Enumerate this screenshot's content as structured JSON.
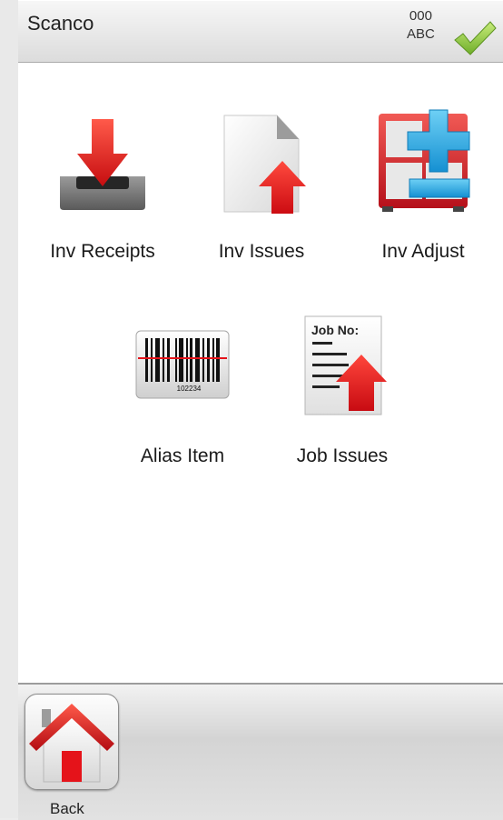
{
  "header": {
    "title": "Scanco",
    "status_line1": "000",
    "status_line2": "ABC",
    "confirm_icon": "green-checkmark-icon"
  },
  "menu": {
    "items": [
      {
        "label": "Inv Receipts",
        "icon": "inbox-download-icon"
      },
      {
        "label": "Inv Issues",
        "icon": "document-upload-icon"
      },
      {
        "label": "Inv Adjust",
        "icon": "cabinet-plus-icon"
      },
      {
        "label": "Alias Item",
        "icon": "barcode-icon"
      },
      {
        "label": "Job Issues",
        "icon": "job-document-upload-icon"
      }
    ]
  },
  "job_icon_text": "Job No:",
  "barcode_number": "102234",
  "footer": {
    "back_label": "Back",
    "back_icon": "home-icon"
  },
  "colors": {
    "accent_red": "#e5131a",
    "check_green": "#8cc63f",
    "header_bg": "#e6e6e6"
  }
}
